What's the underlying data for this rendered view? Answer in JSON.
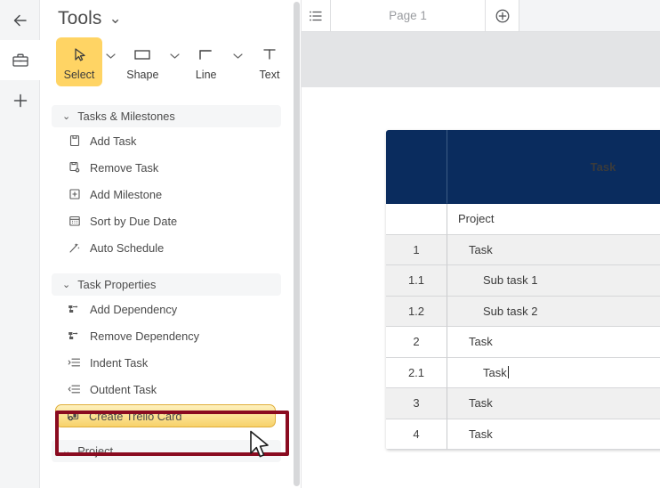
{
  "rail": {
    "items": [
      {
        "name": "back-arrow-icon",
        "label": "Back"
      },
      {
        "name": "toolbox-icon",
        "label": "Toolbox"
      },
      {
        "name": "add-icon",
        "label": "Add"
      }
    ]
  },
  "tools_panel": {
    "title": "Tools",
    "title_chevron": "⌄",
    "toolbar": [
      {
        "label": "Select",
        "icon": "cursor-arrow-icon",
        "active": true,
        "has_caret": true
      },
      {
        "label": "Shape",
        "icon": "rectangle-icon",
        "active": false,
        "has_caret": true
      },
      {
        "label": "Line",
        "icon": "step-line-icon",
        "active": false,
        "has_caret": true
      },
      {
        "label": "Text",
        "icon": "text-t-icon",
        "active": false,
        "has_caret": false
      }
    ],
    "sections": [
      {
        "title": "Tasks & Milestones",
        "chevron": "⌄",
        "items": [
          {
            "label": "Add Task",
            "icon": "add-task-icon"
          },
          {
            "label": "Remove Task",
            "icon": "remove-task-icon"
          },
          {
            "label": "Add Milestone",
            "icon": "add-milestone-icon"
          },
          {
            "label": "Sort by Due Date",
            "icon": "calendar-sort-icon"
          },
          {
            "label": "Auto Schedule",
            "icon": "auto-schedule-wand-icon"
          }
        ]
      },
      {
        "title": "Task Properties",
        "chevron": "⌄",
        "items": [
          {
            "label": "Add Dependency",
            "icon": "add-dependency-icon"
          },
          {
            "label": "Remove Dependency",
            "icon": "remove-dependency-icon"
          },
          {
            "label": "Indent Task",
            "icon": "indent-task-icon"
          },
          {
            "label": "Outdent Task",
            "icon": "outdent-task-icon"
          },
          {
            "label": "Create Trello Card",
            "icon": "create-trello-card-icon",
            "highlighted": true
          }
        ]
      },
      {
        "title": "Project",
        "chevron": "⌄",
        "items": []
      }
    ]
  },
  "canvas": {
    "tabs": {
      "list_icon": "page-list-icon",
      "pages": [
        {
          "label": "Page 1",
          "selected": true
        }
      ],
      "add_label": "⊕",
      "add_icon": "add-page-icon"
    }
  },
  "table": {
    "columns": [
      {
        "key": "num",
        "label": ""
      },
      {
        "key": "task",
        "label": "Task"
      }
    ],
    "rows": [
      {
        "num": "",
        "task": "Project",
        "indent": 0,
        "shaded": false,
        "editing": false
      },
      {
        "num": "1",
        "task": "Task",
        "indent": 1,
        "shaded": true,
        "editing": false
      },
      {
        "num": "1.1",
        "task": "Sub task 1",
        "indent": 2,
        "shaded": true,
        "editing": false
      },
      {
        "num": "1.2",
        "task": "Sub task 2",
        "indent": 2,
        "shaded": true,
        "editing": false
      },
      {
        "num": "2",
        "task": "Task",
        "indent": 1,
        "shaded": false,
        "editing": false
      },
      {
        "num": "2.1",
        "task": "Task",
        "indent": 2,
        "shaded": false,
        "editing": true
      },
      {
        "num": "3",
        "task": "Task",
        "indent": 1,
        "shaded": true,
        "editing": false
      },
      {
        "num": "4",
        "task": "Task",
        "indent": 1,
        "shaded": false,
        "editing": false
      }
    ]
  },
  "colors": {
    "header_navy": "#0a2c5e",
    "accent_yellow": "#ffd464",
    "annotation_red": "#8a0b20",
    "row_shaded": "#f0f0f0",
    "band_gray": "#e3e4e6"
  },
  "annotation": {
    "present": true,
    "target": "Create Trello Card"
  }
}
